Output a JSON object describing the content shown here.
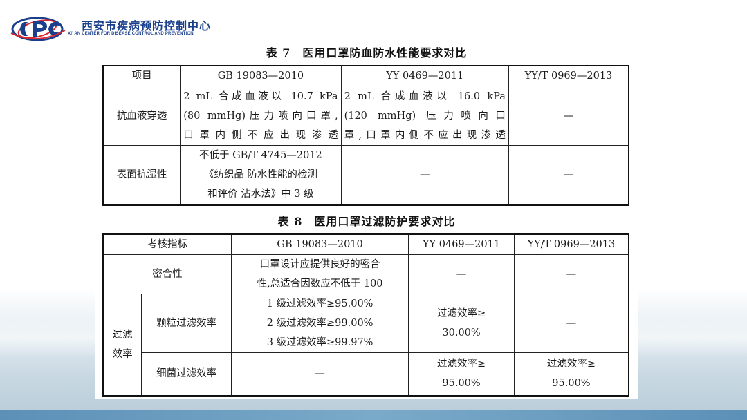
{
  "header": {
    "org_cn": "西安市疾病预防控制中心",
    "org_en": "XI' AN CENTER FOR DISEASE CONTROL AND PREVENTION",
    "brand_color": "#1a3f8c",
    "accent_color": "#d9282f"
  },
  "table7": {
    "caption": "表 7　医用口罩防血防水性能要求对比",
    "headers": [
      "项目",
      "GB 19083—2010",
      "YY 0469—2011",
      "YY/T 0969—2013"
    ],
    "rows": [
      {
        "label": "抗血液穿透",
        "gb": [
          "2 mL 合成血液以 10.7 kPa",
          "(80 mmHg)压力喷向口罩,",
          "口罩内侧不应出现渗透"
        ],
        "yy": [
          "2 mL 合成血液以 16.0 kPa",
          "(120 mmHg) 压力喷向口",
          "罩,口罩内侧不应出现渗透"
        ],
        "yyt": "—"
      },
      {
        "label": "表面抗湿性",
        "gb": [
          "不低于 GB/T 4745—2012",
          "《纺织品 防水性能的检测",
          "和评价 沾水法》中 3 级"
        ],
        "yy": "—",
        "yyt": "—"
      }
    ]
  },
  "table8": {
    "caption": "表 8　医用口罩过滤防护要求对比",
    "headers": [
      "考核指标",
      "GB 19083—2010",
      "YY 0469—2011",
      "YY/T 0969—2013"
    ],
    "seal": {
      "label": "密合性",
      "gb": [
        "口罩设计应提供良好的密合",
        "性,总适合因数应不低于 100"
      ],
      "yy": "—",
      "yyt": "—"
    },
    "filter_group": [
      "过滤",
      "效率"
    ],
    "particle": {
      "label": "颗粒过滤效率",
      "gb": [
        "1 级过滤效率≥95.00%",
        "2 级过滤效率≥99.00%",
        "3 级过滤效率≥99.97%"
      ],
      "yy": [
        "过滤效率≥",
        "30.00%"
      ],
      "yyt": "—"
    },
    "bacteria": {
      "label": "细菌过滤效率",
      "gb": "—",
      "yy": [
        "过滤效率≥",
        "95.00%"
      ],
      "yyt": [
        "过滤效率≥",
        "95.00%"
      ]
    }
  }
}
